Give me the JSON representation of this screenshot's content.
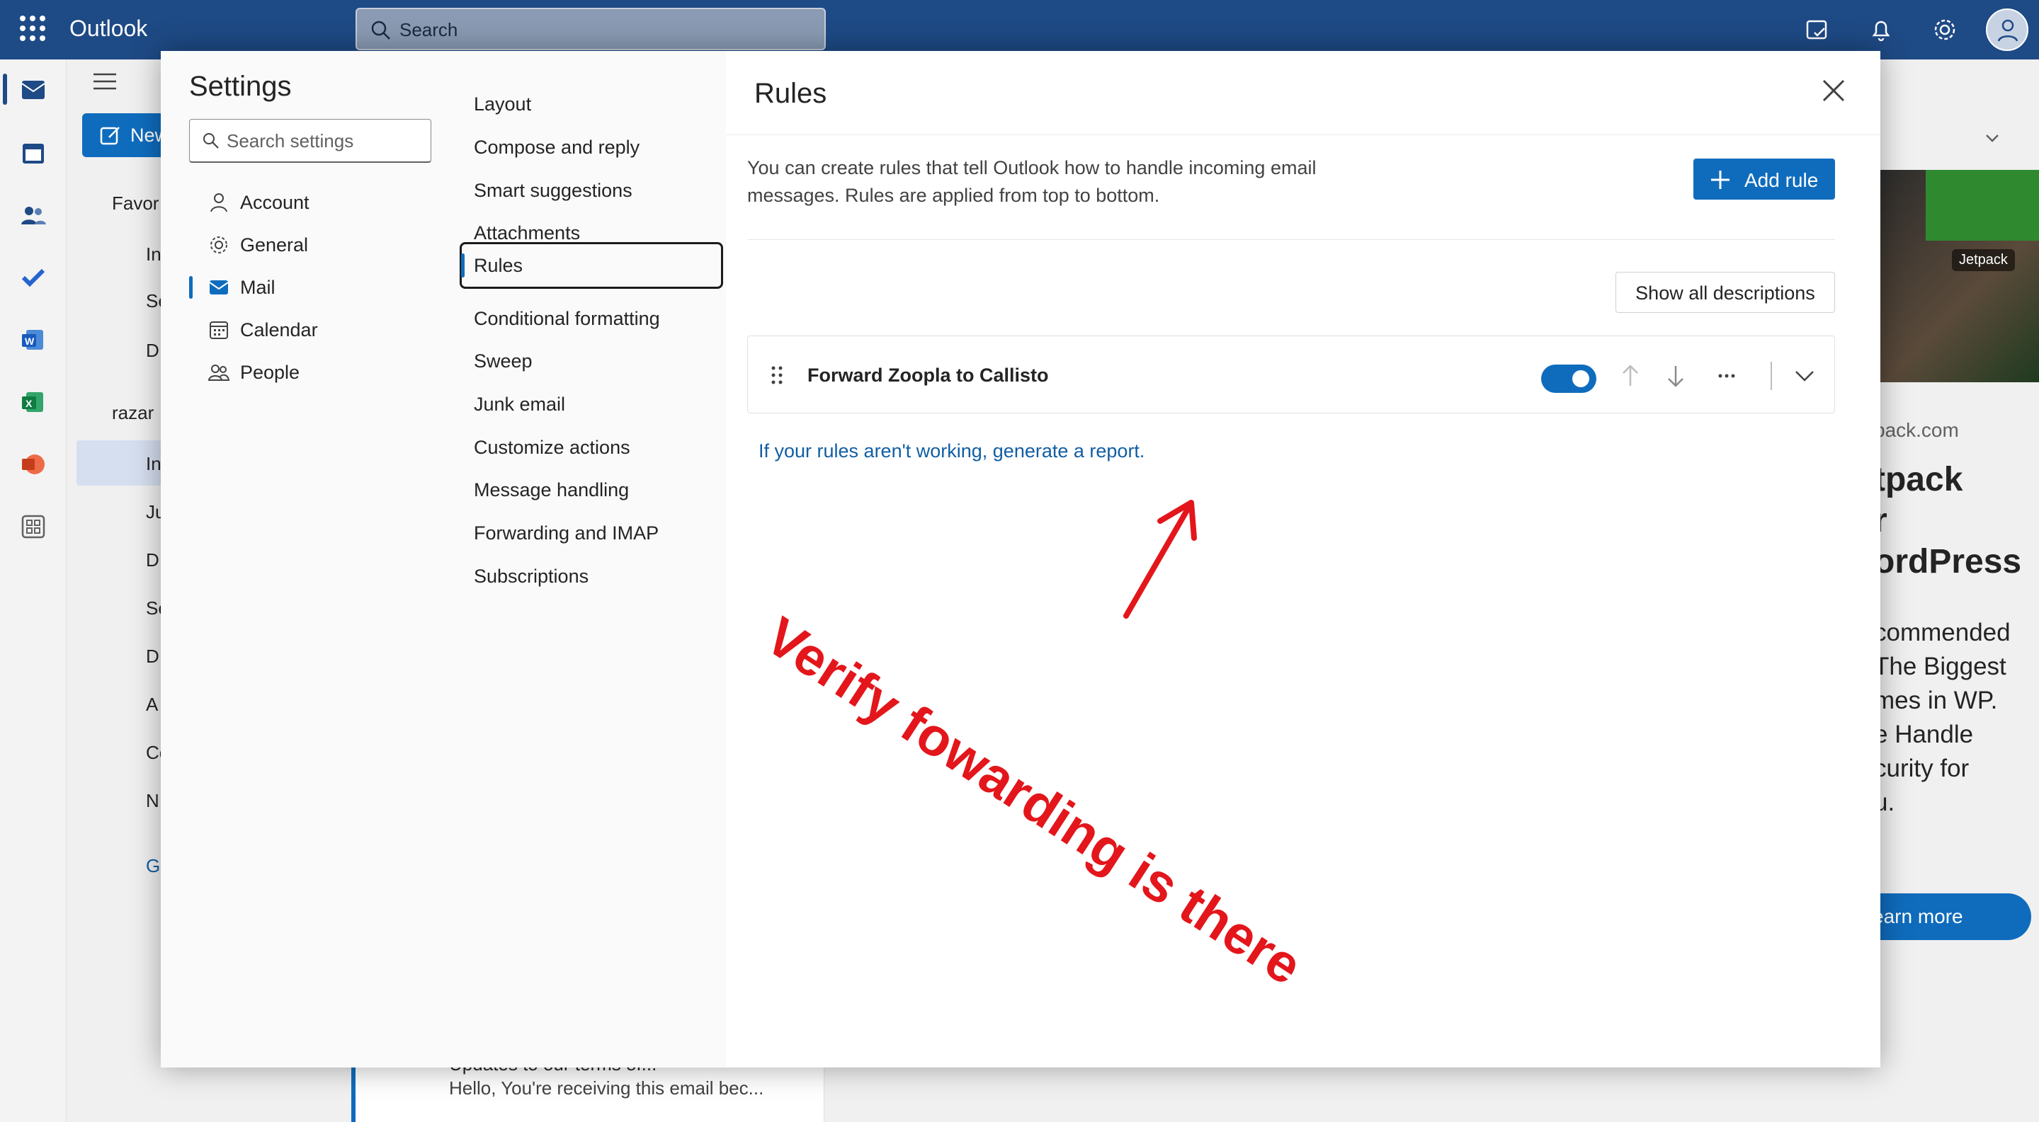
{
  "app": {
    "title": "Outlook",
    "accent": "#1e4a85",
    "primary_button": "#0f6cbd"
  },
  "topbar": {
    "search_placeholder": "Search"
  },
  "background": {
    "new_button": "New",
    "folders_partial": [
      "Favor",
      "In",
      "Se",
      "D",
      "razar",
      "In",
      "Ju",
      "D",
      "Se",
      "D",
      "A",
      "Co",
      "N",
      "G"
    ],
    "list_item": {
      "title": "Updates to our terms of...",
      "body": "Hello, You're receiving this email bec..."
    },
    "ad": {
      "badge": "Jetpack",
      "domain": "pack.com",
      "title_lines": [
        "tpack",
        "r",
        "ordPress"
      ],
      "body_lines": [
        "commended",
        " The Biggest",
        "mes in WP.",
        "e Handle",
        "curity for",
        "u."
      ],
      "cta": "earn more"
    }
  },
  "settings": {
    "title": "Settings",
    "search_placeholder": "Search settings",
    "categories": [
      {
        "label": "Account",
        "icon": "person-icon"
      },
      {
        "label": "General",
        "icon": "gear-icon"
      },
      {
        "label": "Mail",
        "icon": "mail-icon",
        "selected": true
      },
      {
        "label": "Calendar",
        "icon": "calendar-icon"
      },
      {
        "label": "People",
        "icon": "people-icon"
      }
    ],
    "mail_sections": [
      "Layout",
      "Compose and reply",
      "Smart suggestions",
      "Attachments",
      "Rules",
      "Conditional formatting",
      "Sweep",
      "Junk email",
      "Customize actions",
      "Message handling",
      "Forwarding and IMAP",
      "Subscriptions"
    ],
    "selected_section": "Rules"
  },
  "rules": {
    "title": "Rules",
    "description": "You can create rules that tell Outlook how to handle incoming email messages. Rules are applied from top to bottom.",
    "add_rule_label": "Add rule",
    "show_descriptions_label": "Show all descriptions",
    "items": [
      {
        "name": "Forward Zoopla to Callisto",
        "enabled": true
      }
    ],
    "report_link": "If your rules aren't working, generate a report."
  },
  "annotation": {
    "text": "Verify fowarding is there",
    "color": "#e3161b"
  }
}
